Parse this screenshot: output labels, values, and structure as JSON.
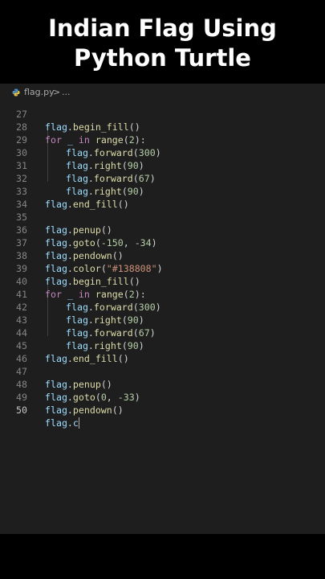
{
  "video_title": {
    "line1": "Indian Flag Using",
    "line2": "Python Turtle"
  },
  "breadcrumb": {
    "file_icon": "python-file-icon",
    "file": "flag.py",
    "separator": ">",
    "more": "..."
  },
  "lines": [
    {
      "n": "27",
      "t": "flag.begin_fill()"
    },
    {
      "n": "28",
      "t": "for _ in range(2):"
    },
    {
      "n": "29",
      "t": "flag.forward(300)"
    },
    {
      "n": "30",
      "t": "flag.right(90)"
    },
    {
      "n": "31",
      "t": "flag.forward(67)"
    },
    {
      "n": "32",
      "t": "flag.right(90)"
    },
    {
      "n": "33",
      "t": "flag.end_fill()"
    },
    {
      "n": "34",
      "t": ""
    },
    {
      "n": "35",
      "t": "flag.penup()"
    },
    {
      "n": "36",
      "t": "flag.goto(-150, -34)"
    },
    {
      "n": "37",
      "t": "flag.pendown()"
    },
    {
      "n": "38",
      "t": "flag.color(\"#138808\")"
    },
    {
      "n": "39",
      "t": "flag.begin_fill()"
    },
    {
      "n": "40",
      "t": "for _ in range(2):"
    },
    {
      "n": "41",
      "t": "flag.forward(300)"
    },
    {
      "n": "42",
      "t": "flag.right(90)"
    },
    {
      "n": "43",
      "t": "flag.forward(67)"
    },
    {
      "n": "44",
      "t": "flag.right(90)"
    },
    {
      "n": "45",
      "t": "flag.end_fill()"
    },
    {
      "n": "46",
      "t": ""
    },
    {
      "n": "47",
      "t": "flag.penup()"
    },
    {
      "n": "48",
      "t": "flag.goto(0, -33)"
    },
    {
      "n": "49",
      "t": "flag.pendown()"
    },
    {
      "n": "50",
      "t": "flag.c"
    }
  ],
  "active_line": "50",
  "colors": {
    "editor_bg": "#1e1e1e",
    "variable": "#9cdcfe",
    "function": "#dcdcaa",
    "number": "#b5cea8",
    "string": "#ce9178",
    "keyword": "#c586c0"
  }
}
